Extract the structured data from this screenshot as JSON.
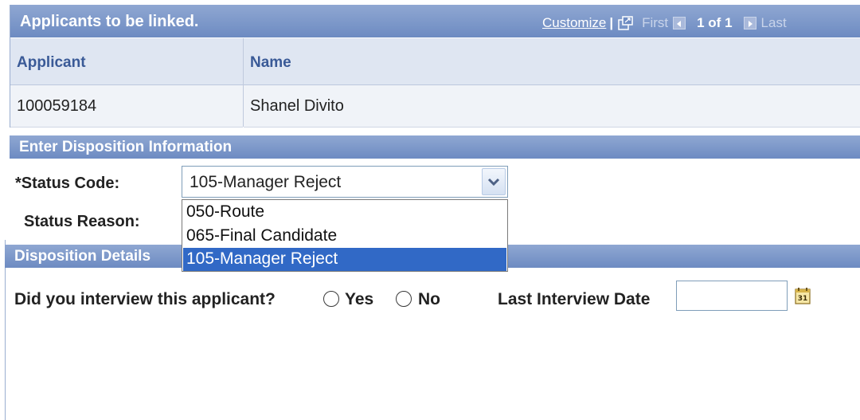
{
  "applicants_grid": {
    "title": "Applicants to be linked.",
    "nav": {
      "customize": "Customize",
      "separator": "|",
      "first": "First",
      "count": "1 of 1",
      "last": "Last"
    },
    "columns": [
      "Applicant",
      "Name"
    ],
    "rows": [
      {
        "applicant": "100059184",
        "name": "Shanel Divito"
      }
    ]
  },
  "disposition": {
    "title": "Enter Disposition Information",
    "status_code_required": "*",
    "status_code_label": "Status Code:",
    "status_code_value": "105-Manager Reject",
    "status_reason_label": "Status Reason:",
    "options": [
      "050-Route",
      "065-Final Candidate",
      "105-Manager Reject"
    ],
    "selected_option": "105-Manager Reject"
  },
  "details": {
    "title": "Disposition Details",
    "interview_question": "Did you interview this applicant?",
    "yes_label": "Yes",
    "no_label": "No",
    "last_interview_label": "Last Interview Date",
    "last_interview_value": "",
    "calendar_day": "31"
  },
  "colors": {
    "header_gradient_top": "#8fa7d2",
    "header_gradient_bottom": "#6d8bc2",
    "column_header_bg": "#dfe6f2",
    "selection": "#3169c6"
  }
}
